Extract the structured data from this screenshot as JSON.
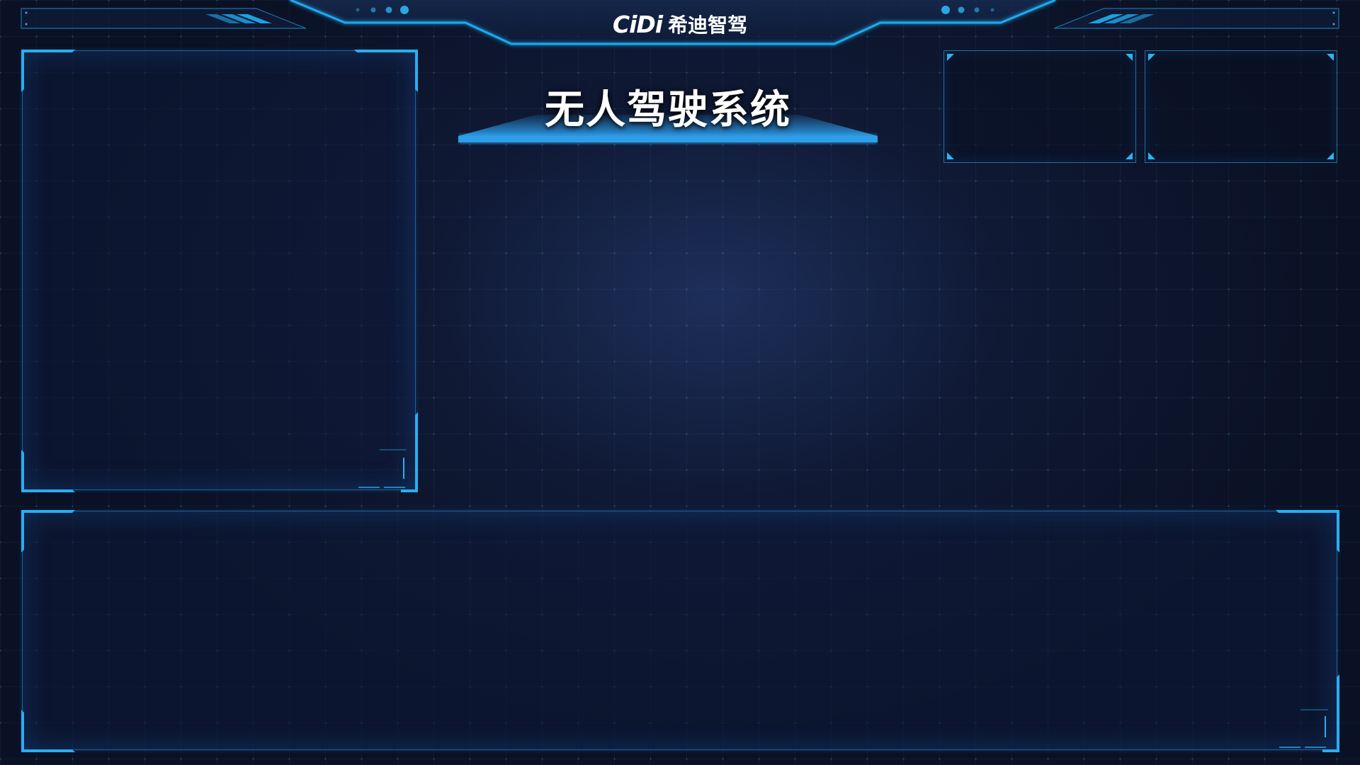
{
  "header": {
    "logo_mark": "CiDi",
    "logo_text": "希迪智驾"
  },
  "title": {
    "text": "无人驾驶系统"
  },
  "panels": {
    "left": {
      "name": "left-panel"
    },
    "bottom": {
      "name": "bottom-panel"
    },
    "small_1": {
      "name": "top-right-panel-1"
    },
    "small_2": {
      "name": "top-right-panel-2"
    }
  },
  "colors": {
    "accent": "#1e9fe6",
    "accent_light": "#36c3ff",
    "background": "#0b1327",
    "panel_border": "#238cdc",
    "title_text": "#ffffff"
  },
  "icons": [
    "logo-mark-icon",
    "header-dots-icon",
    "header-stripes-icon",
    "corner-bracket-icon"
  ]
}
